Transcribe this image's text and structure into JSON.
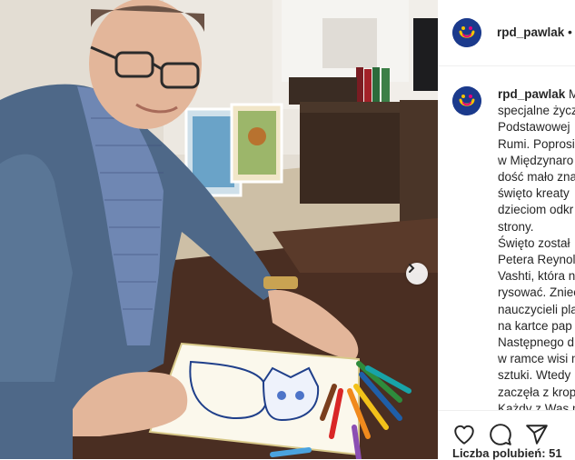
{
  "post": {
    "username": "rpd_pawlak",
    "header_separator": "•",
    "caption_lines": [
      "Mi",
      "specjalne życz",
      "Podstawowej",
      "Rumi. Poprosi",
      "w Międzynaro",
      "dość mało zna",
      "święto kreaty",
      "dzieciom odkr",
      "strony.",
      "Święto został",
      "Petera Reynol",
      "Vashti, która n",
      "rysować. Zniec",
      "nauczycieli pla",
      "na kartce pap",
      "Następnego d",
      "w ramce wisi n",
      "sztuki. Wtedy",
      "zaczęła z krop",
      "Każdy z Was m"
    ],
    "likes_text": "Liczba polubień: 51"
  },
  "icons": {
    "avatar": "rpd-logo-avatar",
    "next": "chevron-right-icon",
    "like": "heart-icon",
    "comment": "comment-icon",
    "share": "paper-plane-icon"
  },
  "colors": {
    "avatar_bg": "#1b3a8c",
    "logo_yellow": "#f5c400",
    "logo_pink": "#e6007e"
  }
}
